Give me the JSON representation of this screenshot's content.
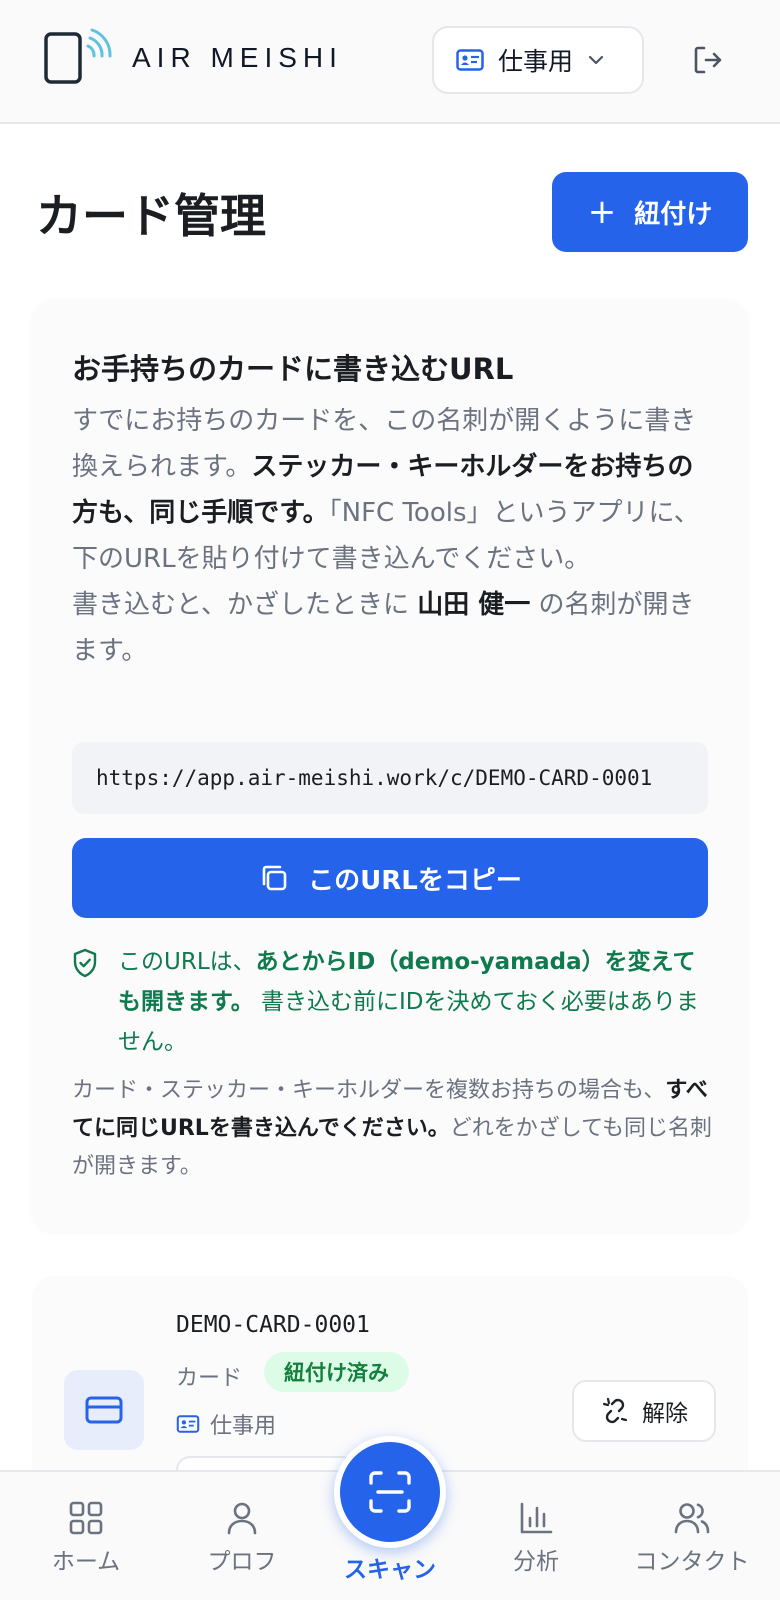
{
  "header": {
    "brand": "AIR MEISHI",
    "profile_selector": "仕事用"
  },
  "page": {
    "title": "カード管理",
    "link_button": "紐付け"
  },
  "write_info": {
    "title": "お手持ちのカードに書き込むURL",
    "desc_1": "すでにお持ちのカードを、この名刺が開くように書き換えられます。",
    "desc_bold": "ステッカー・キーホルダーをお持ちの方も、同じ手順です。",
    "desc_2": "「NFC Tools」というアプリに、下のURLを貼り付けて書き込んでください。",
    "desc_3a": "書き込むと、かざしたときに ",
    "desc_name": "山田 健一",
    "desc_3b": " の名刺が開きます。",
    "url": "https://app.air-meishi.work/c/DEMO-CARD-0001",
    "copy_button": "このURLをコピー",
    "note_a": "このURLは、",
    "note_bold": "あとからID（demo-yamada）を変えても開きます。",
    "note_b": " 書き込む前にIDを決めておく必要はありません。",
    "multi_a": "カード・ステッカー・キーホルダーを複数お持ちの場合も、",
    "multi_bold": "すべてに同じURLを書き込んでください。",
    "multi_b": "どれをかざしても同じ名刺が開きます。"
  },
  "card": {
    "id": "DEMO-CARD-0001",
    "type": "カード",
    "status": "紐付け済み",
    "profile": "仕事用",
    "unlink_button": "解除"
  },
  "nav": {
    "home": "ホーム",
    "profile": "プロフ",
    "scan": "スキャン",
    "analytics": "分析",
    "contacts": "コンタクト"
  },
  "colors": {
    "primary": "#2563eb",
    "success": "#0f7a4d",
    "badge_bg": "#dcfce7"
  }
}
